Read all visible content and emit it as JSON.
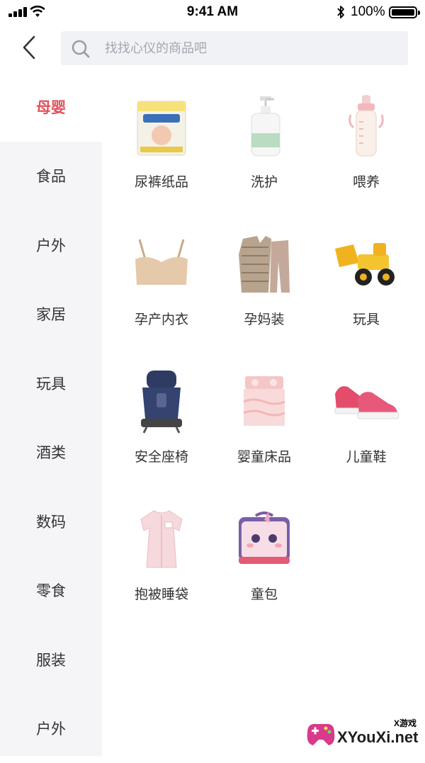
{
  "status_bar": {
    "time": "9:41 AM",
    "battery_percent": "100%"
  },
  "nav": {
    "back_icon": "chevron-left-icon",
    "search_icon": "search-icon",
    "search_placeholder": "找找心仪的商品吧",
    "search_value": ""
  },
  "sidebar": {
    "active_index": 0,
    "items": [
      {
        "label": "母婴"
      },
      {
        "label": "食品"
      },
      {
        "label": "户外"
      },
      {
        "label": "家居"
      },
      {
        "label": "玩具"
      },
      {
        "label": "酒类"
      },
      {
        "label": "数码"
      },
      {
        "label": "零食"
      },
      {
        "label": "服装"
      },
      {
        "label": "户外"
      }
    ]
  },
  "categories": [
    {
      "label": "尿裤纸品",
      "icon": "diaper-pack-icon"
    },
    {
      "label": "洗护",
      "icon": "lotion-bottle-icon"
    },
    {
      "label": "喂养",
      "icon": "baby-bottle-icon"
    },
    {
      "label": "孕产内衣",
      "icon": "maternity-bra-icon"
    },
    {
      "label": "孕妈装",
      "icon": "maternity-pajamas-icon"
    },
    {
      "label": "玩具",
      "icon": "toy-bulldozer-icon"
    },
    {
      "label": "安全座椅",
      "icon": "car-seat-icon"
    },
    {
      "label": "婴童床品",
      "icon": "baby-bedding-icon"
    },
    {
      "label": "儿童鞋",
      "icon": "kids-shoes-icon"
    },
    {
      "label": "抱被睡袋",
      "icon": "sleeping-bag-icon"
    },
    {
      "label": "童包",
      "icon": "kids-bag-icon"
    }
  ],
  "watermark": {
    "small_text": "X游戏",
    "text": "XYouXi.net"
  },
  "colors": {
    "accent": "#e0535b",
    "sidebar_bg": "#f5f5f8",
    "search_bg": "#f1f2f6"
  }
}
